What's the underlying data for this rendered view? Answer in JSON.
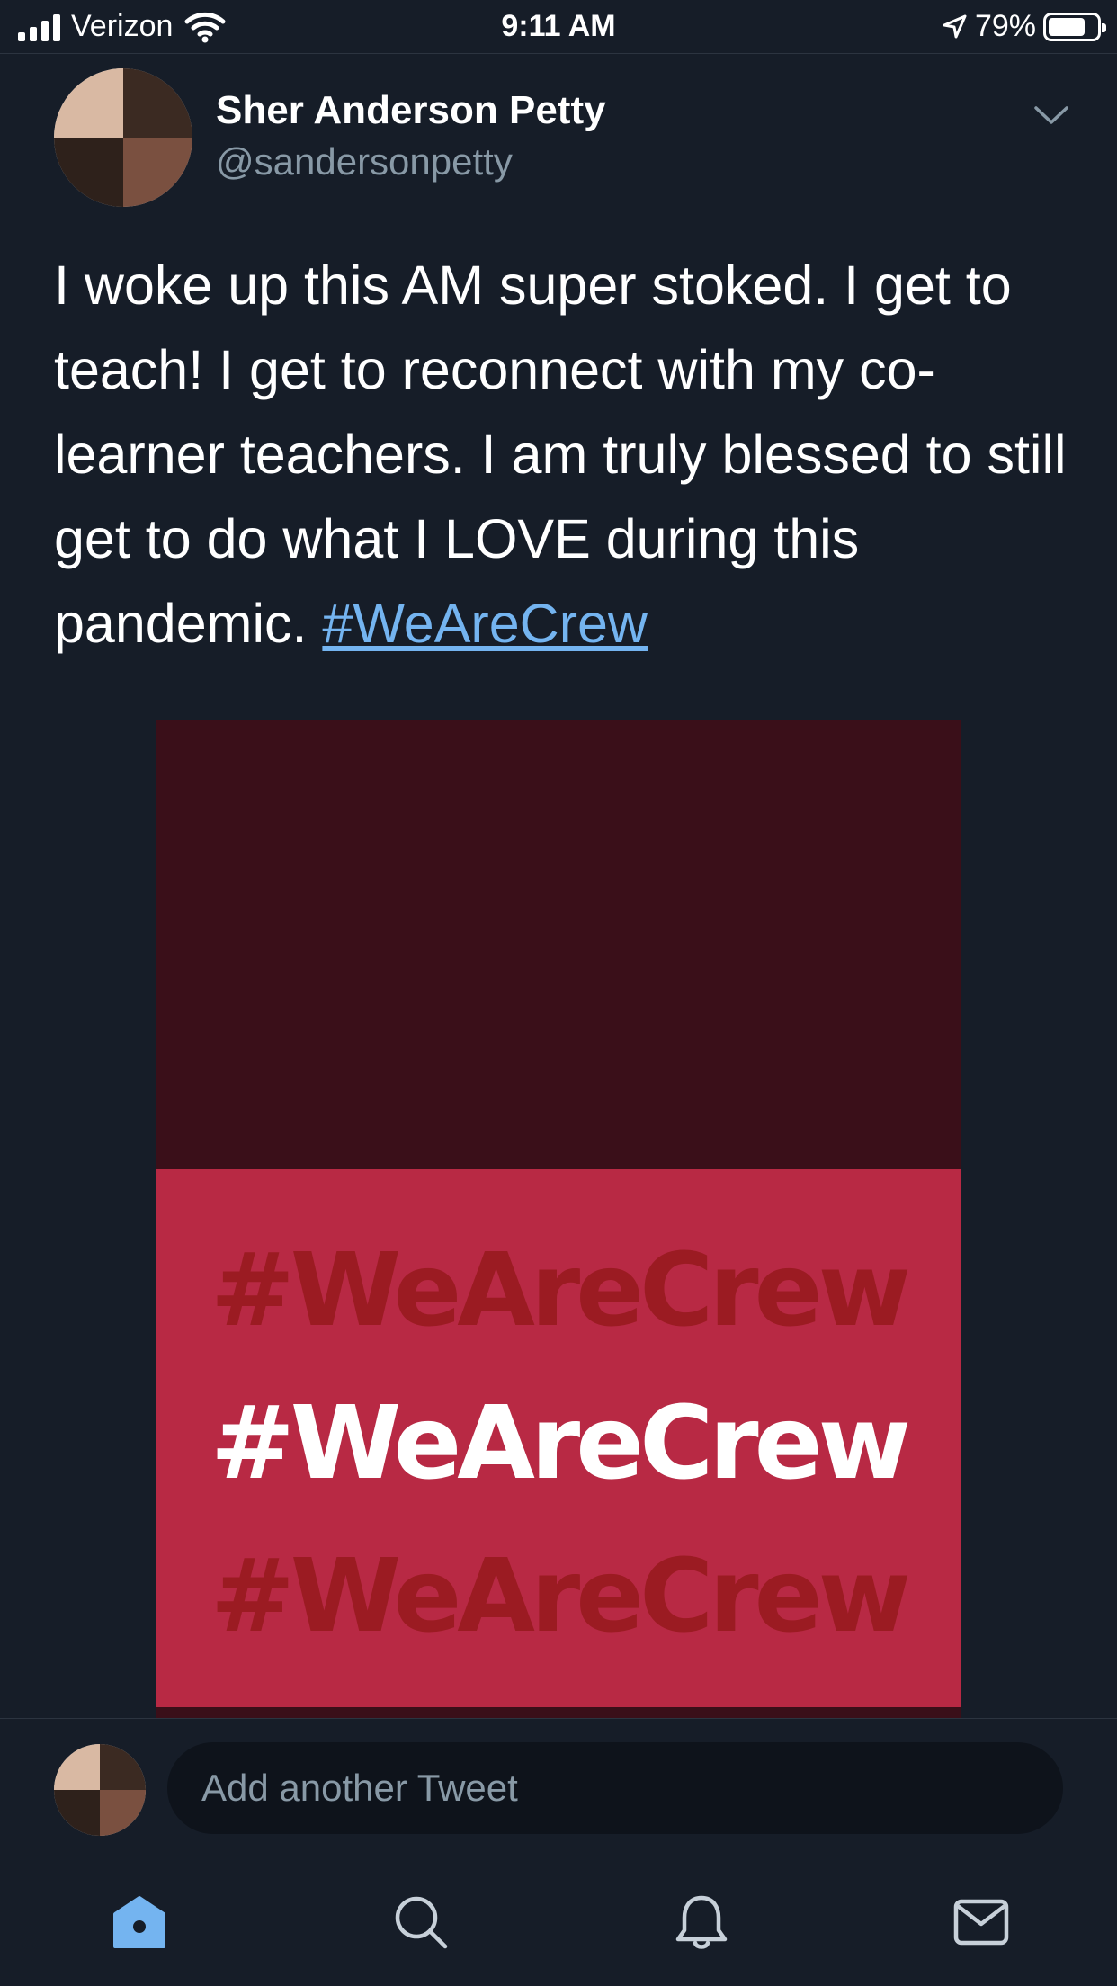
{
  "status_bar": {
    "carrier": "Verizon",
    "time": "9:11 AM",
    "battery": "79%",
    "battery_level": 0.79,
    "icons": [
      "signal-icon",
      "wifi-icon",
      "location-arrow-icon",
      "battery-icon"
    ]
  },
  "tweet": {
    "display_name": "Sher Anderson Petty",
    "handle": "@sandersonpetty",
    "text_before": "I woke up this AM super stoked. I get to teach! I get to reconnect with my co-learner teachers. I am truly blessed to still get to do what I LOVE during this pandemic. ",
    "hashtag": "#WeAreCrew",
    "media": {
      "lines": [
        "#WeAreCrew",
        "#WeAreCrew",
        "#WeAreCrew"
      ],
      "colors": {
        "top": "#3a0f19",
        "bottom": "#b82944",
        "faded_text": "#9b1b22",
        "text": "#ffffff"
      }
    }
  },
  "reply": {
    "placeholder": "Add another Tweet"
  },
  "tab_bar": {
    "items": [
      "home-icon",
      "search-icon",
      "notifications-icon",
      "messages-icon"
    ],
    "active": "home-icon",
    "accent": "#74b4f0"
  },
  "colors": {
    "background": "#161d28",
    "secondary_text": "#8899a6",
    "link": "#74b4f0"
  }
}
